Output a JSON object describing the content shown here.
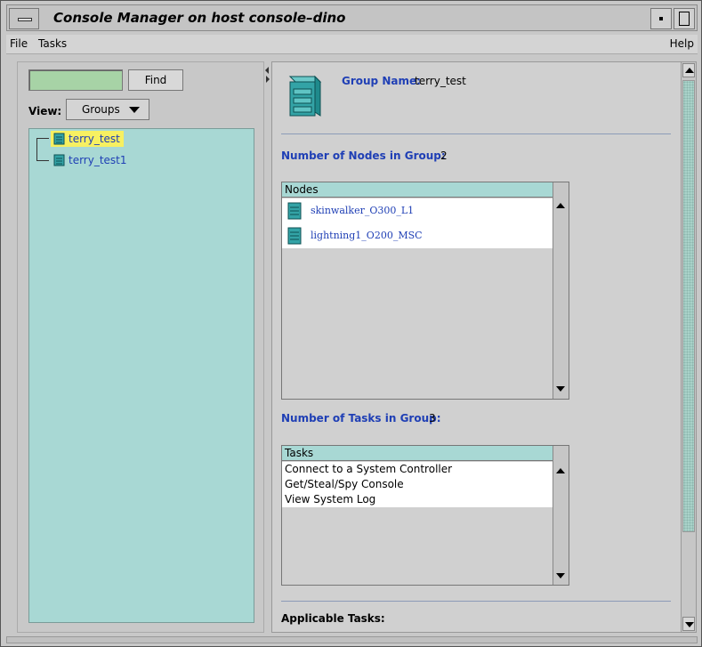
{
  "window": {
    "title": "Console Manager on host console–dino"
  },
  "menubar": {
    "file": "File",
    "tasks": "Tasks",
    "help": "Help"
  },
  "left_panel": {
    "find_input_value": "",
    "find_button": "Find",
    "view_label": "View:",
    "view_selected": "Groups",
    "tree": [
      {
        "label": "terry_test",
        "selected": true
      },
      {
        "label": "terry_test1",
        "selected": false
      }
    ]
  },
  "right_panel": {
    "group_name_label": "Group Name:",
    "group_name_value": "terry_test",
    "nodes_count_label": "Number of Nodes in Group:",
    "nodes_count_value": "2",
    "nodes_header": "Nodes",
    "nodes": [
      "skinwalker_O300_L1",
      "lightning1_O200_MSC"
    ],
    "tasks_count_label": "Number of Tasks in Group:",
    "tasks_count_value": "3",
    "tasks_header": "Tasks",
    "tasks": [
      "Connect to a System Controller",
      "Get/Steal/Spy Console",
      "View System Log"
    ],
    "applicable_tasks_label": "Applicable Tasks:"
  },
  "colors": {
    "tree_bg": "#a8d8d4",
    "selection": "#f7f061",
    "link_blue": "#1f3fb5",
    "find_field": "#a7d3a6",
    "icon_teal": "#33a3a6"
  }
}
